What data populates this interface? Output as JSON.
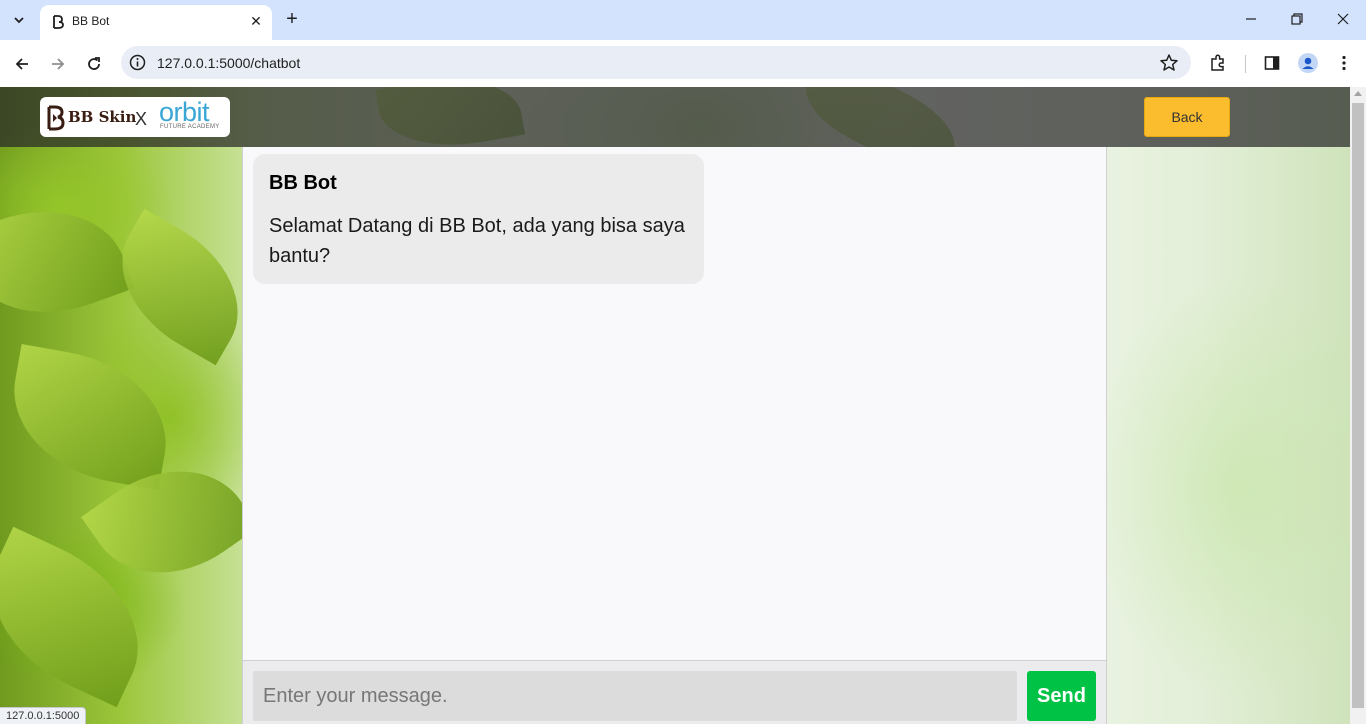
{
  "browser": {
    "tab_title": "BB Bot",
    "url": "127.0.0.1:5000/chatbot",
    "status_url": "127.0.0.1:5000"
  },
  "header": {
    "logo_brand": "BB Skin",
    "logo_separator": "X",
    "logo_partner": "orbit",
    "logo_partner_sub": "FUTURE ACADEMY",
    "back_label": "Back"
  },
  "chat": {
    "messages": [
      {
        "sender": "BB Bot",
        "text": "Selamat Datang di BB Bot, ada yang bisa saya bantu?"
      }
    ],
    "input_placeholder": "Enter your message.",
    "input_value": "",
    "send_label": "Send"
  },
  "colors": {
    "back_button": "#fbbc2e",
    "send_button": "#00c244",
    "bubble": "#ebebeb",
    "header_overlay": "#282828"
  },
  "icons": [
    "tab-list-icon",
    "favicon-icon",
    "close-icon",
    "plus-icon",
    "minimize-icon",
    "restore-icon",
    "back-arrow-icon",
    "forward-arrow-icon",
    "reload-icon",
    "info-icon",
    "star-icon",
    "extensions-icon",
    "side-panel-icon",
    "profile-icon",
    "more-icon"
  ]
}
